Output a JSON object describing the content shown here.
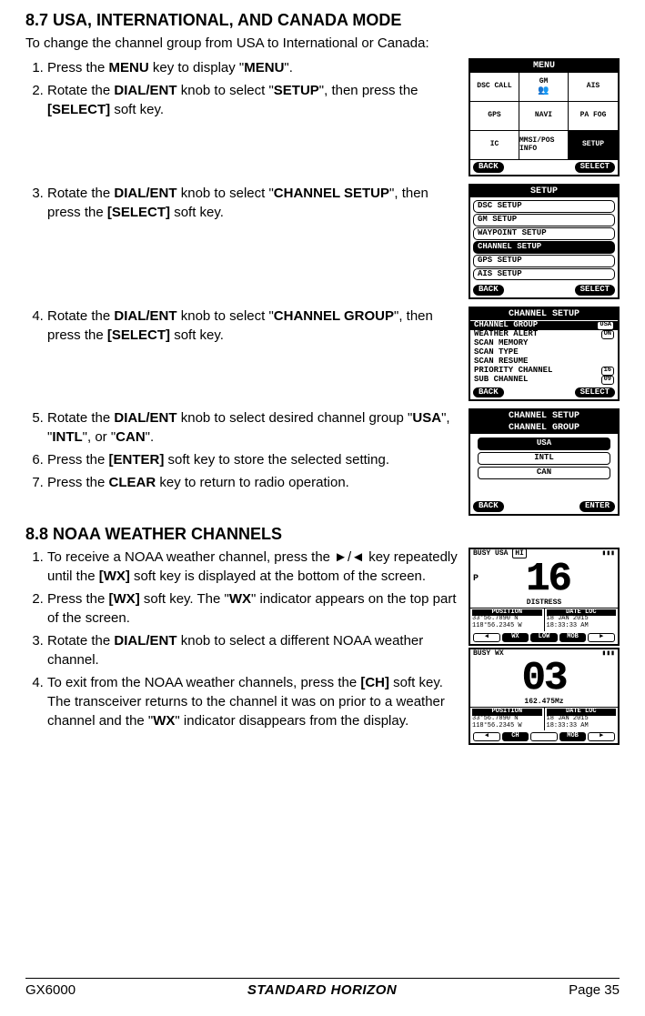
{
  "section87": {
    "heading": "8.7    USA, INTERNATIONAL, AND CANADA MODE",
    "intro": "To change the channel group from USA to International or Canada:",
    "step1_pre": "Press the ",
    "step1_b1": "MENU",
    "step1_mid": " key to display \"",
    "step1_b2": "MENU",
    "step1_post": "\".",
    "step2_pre": "Rotate the ",
    "step2_b1": "DIAL/ENT",
    "step2_mid1": " knob to select \"",
    "step2_b2": "SETUP",
    "step2_mid2": "\", then press the ",
    "step2_b3": "[SELECT]",
    "step2_post": " soft key.",
    "step3_pre": "Rotate the ",
    "step3_b1": "DIAL/ENT",
    "step3_mid1": " knob to select \"",
    "step3_b2": "CHANNEL SETUP",
    "step3_mid2": "\", then press the ",
    "step3_b3": "[SELECT]",
    "step3_post": " soft key.",
    "step4_pre": "Rotate the ",
    "step4_b1": "DIAL/ENT",
    "step4_mid1": " knob to select \"",
    "step4_b2": "CHANNEL GROUP",
    "step4_mid2": "\", then press the ",
    "step4_b3": "[SELECT]",
    "step4_post": " soft key.",
    "step5_pre": "Rotate the ",
    "step5_b1": "DIAL/ENT",
    "step5_mid1": " knob to select desired channel group \"",
    "step5_b2": "USA",
    "step5_mid2": "\", \"",
    "step5_b3": "INTL",
    "step5_mid3": "\", or \"",
    "step5_b4": "CAN",
    "step5_post": "\".",
    "step6_pre": "Press the ",
    "step6_b1": "[ENTER]",
    "step6_post": " soft key to store the selected setting.",
    "step7_pre": "Press the ",
    "step7_b1": "CLEAR",
    "step7_post": " key to return to radio operation."
  },
  "section88": {
    "heading": "8.8    NOAA WEATHER CHANNELS",
    "step1_pre": "To receive a NOAA weather channel, press the ►/◄ key repeatedly until the ",
    "step1_b1": "[WX]",
    "step1_post": " soft key is displayed at the bottom of the screen.",
    "step2_pre": "Press the ",
    "step2_b1": "[WX]",
    "step2_mid1": " soft key. The \"",
    "step2_b2": "WX",
    "step2_post": "\" indicator appears on the top part of the screen.",
    "step3_pre": "Rotate the ",
    "step3_b1": "DIAL/ENT",
    "step3_post": " knob to select a different NOAA weather channel.",
    "step4_pre": "To exit from the NOAA weather channels, press the ",
    "step4_b1": "[CH]",
    "step4_mid1": " soft key. The transceiver returns to the channel it was on prior to a weather channel and the \"",
    "step4_b2": "WX",
    "step4_post": "\" indicator disappears from the display."
  },
  "lcd1": {
    "title": "MENU",
    "cells": [
      "DSC CALL",
      "GM",
      "AIS",
      "GPS",
      "NAVI",
      "PA FOG",
      "IC",
      "MMSI/POS INFO",
      "SETUP"
    ],
    "back": "BACK",
    "select": "SELECT"
  },
  "lcd2": {
    "title": "SETUP",
    "items": [
      "DSC SETUP",
      "GM SETUP",
      "WAYPOINT SETUP",
      "CHANNEL SETUP",
      "GPS SETUP",
      "AIS SETUP"
    ],
    "back": "BACK",
    "select": "SELECT"
  },
  "lcd3": {
    "title": "CHANNEL SETUP",
    "rows": [
      {
        "label": "CHANNEL GROUP",
        "tag": "USA",
        "sel": true
      },
      {
        "label": "WEATHER ALERT",
        "tag": "ON"
      },
      {
        "label": "SCAN MEMORY",
        "tag": ""
      },
      {
        "label": "SCAN TYPE",
        "tag": ""
      },
      {
        "label": "SCAN RESUME",
        "tag": ""
      },
      {
        "label": "PRIORITY CHANNEL",
        "tag": "16"
      },
      {
        "label": "SUB CHANNEL",
        "tag": "09"
      }
    ],
    "back": "BACK",
    "select": "SELECT"
  },
  "lcd4": {
    "title": "CHANNEL SETUP",
    "sub": "CHANNEL GROUP",
    "opts": [
      "USA",
      "INTL",
      "CAN"
    ],
    "back": "BACK",
    "enter": "ENTER"
  },
  "lcd5": {
    "busy": "BUSY",
    "mode": "USA",
    "hi": "HI",
    "p": "P",
    "channel": "16",
    "name": "DISTRESS",
    "poshdr": "POSITION",
    "datehdr": "DATE LOC",
    "lat": "33°56.7890 N",
    "lon": "118°56.2345 W",
    "date": "18 JAN 2015",
    "time": "18:33:33 AM",
    "keys": [
      "WX",
      "LOW",
      "MOB"
    ]
  },
  "lcd6": {
    "busy": "BUSY",
    "mode": "WX",
    "channel": "03",
    "freq": "162.475Mz",
    "poshdr": "POSITION",
    "datehdr": "DATE LOC",
    "lat": "33°56.7890 N",
    "lon": "118°56.2345 W",
    "date": "18 JAN 2015",
    "time": "18:33:33 AM",
    "keys": [
      "CH",
      "",
      "MOB"
    ]
  },
  "footer": {
    "model": "GX6000",
    "brand": "STANDARD HORIZON",
    "page": "Page 35"
  }
}
